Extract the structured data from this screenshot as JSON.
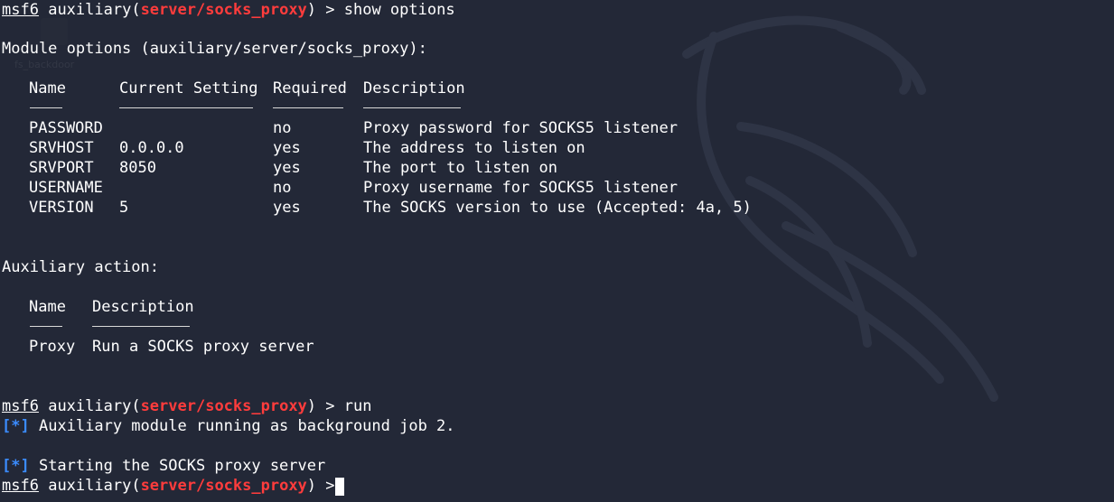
{
  "prompt": {
    "msf": "msf6",
    "pre": "auxiliary(",
    "module": "server/socks_proxy",
    "post": ") > "
  },
  "commands": {
    "first": "show options",
    "second": "run"
  },
  "options_section": {
    "title": "Module options (auxiliary/server/socks_proxy):",
    "headers": {
      "name": "Name",
      "current": "Current Setting",
      "required": "Required",
      "description": "Description"
    },
    "rows": [
      {
        "name": "PASSWORD",
        "current": "",
        "required": "no",
        "description": "Proxy password for SOCKS5 listener"
      },
      {
        "name": "SRVHOST",
        "current": "0.0.0.0",
        "required": "yes",
        "description": "The address to listen on"
      },
      {
        "name": "SRVPORT",
        "current": "8050",
        "required": "yes",
        "description": "The port to listen on"
      },
      {
        "name": "USERNAME",
        "current": "",
        "required": "no",
        "description": "Proxy username for SOCKS5 listener"
      },
      {
        "name": "VERSION",
        "current": "5",
        "required": "yes",
        "description": "The SOCKS version to use (Accepted: 4a, 5)"
      }
    ]
  },
  "action_section": {
    "title": "Auxiliary action:",
    "headers": {
      "name": "Name",
      "description": "Description"
    },
    "rows": [
      {
        "name": "Proxy",
        "description": "Run a SOCKS proxy server"
      }
    ]
  },
  "status": {
    "marker": "[*]",
    "job": " Auxiliary module running as background job 2.",
    "start": " Starting the SOCKS proxy server"
  },
  "colors": {
    "background": "#232837",
    "module": "#ff3c3c",
    "status_marker": "#3b8cff",
    "text": "#ffffff"
  },
  "background_text": "fs_backdoor"
}
